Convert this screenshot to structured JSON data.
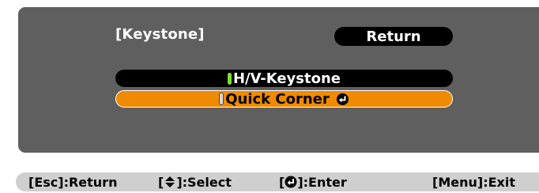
{
  "dialog": {
    "title": "[Keystone]",
    "return_label": "Return",
    "items": [
      {
        "label": "H/V-Keystone",
        "selected": false
      },
      {
        "label": "Quick Corner",
        "selected": true
      }
    ]
  },
  "footer": {
    "esc_open": "[Esc]",
    "esc_action": ":Return",
    "select_open": "[",
    "select_close": "]",
    "select_action": ":Select",
    "enter_open": "[",
    "enter_close": "]",
    "enter_action": ":Enter",
    "menu_open": "[Menu]",
    "menu_action": ":Exit"
  },
  "icons": {
    "select_icon": "up-down-arrow-icon",
    "enter_icon": "enter-icon"
  },
  "colors": {
    "panel": "#5f5f5f",
    "highlight": "#f08a00",
    "footer": "#cfcfcf",
    "active_marker": "#7ddc3b"
  }
}
